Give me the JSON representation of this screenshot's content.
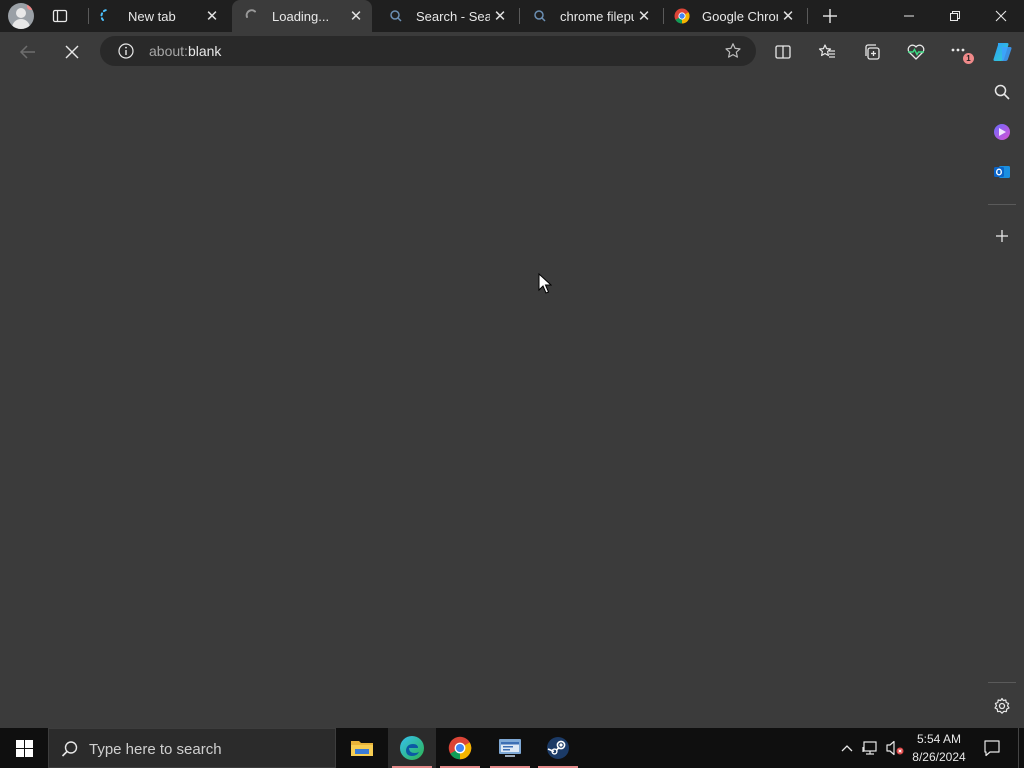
{
  "tabs": [
    {
      "title": "New tab",
      "active": false
    },
    {
      "title": "Loading...",
      "active": true
    },
    {
      "title": "Search - Search",
      "active": false
    },
    {
      "title": "chrome filepun",
      "active": false
    },
    {
      "title": "Google Chrome",
      "active": false
    }
  ],
  "address_bar": {
    "url_prefix": "about:",
    "url_main": "blank"
  },
  "taskbar": {
    "search_placeholder": "Type here to search",
    "time": "5:54 AM",
    "date": "8/26/2024"
  },
  "toolbar": {
    "notification_badge": "1"
  },
  "colors": {
    "accent": "#4cc2ff",
    "background": "#3b3b3b",
    "tabstrip": "#1f1f1f",
    "taskbar": "#0f0f0f"
  }
}
